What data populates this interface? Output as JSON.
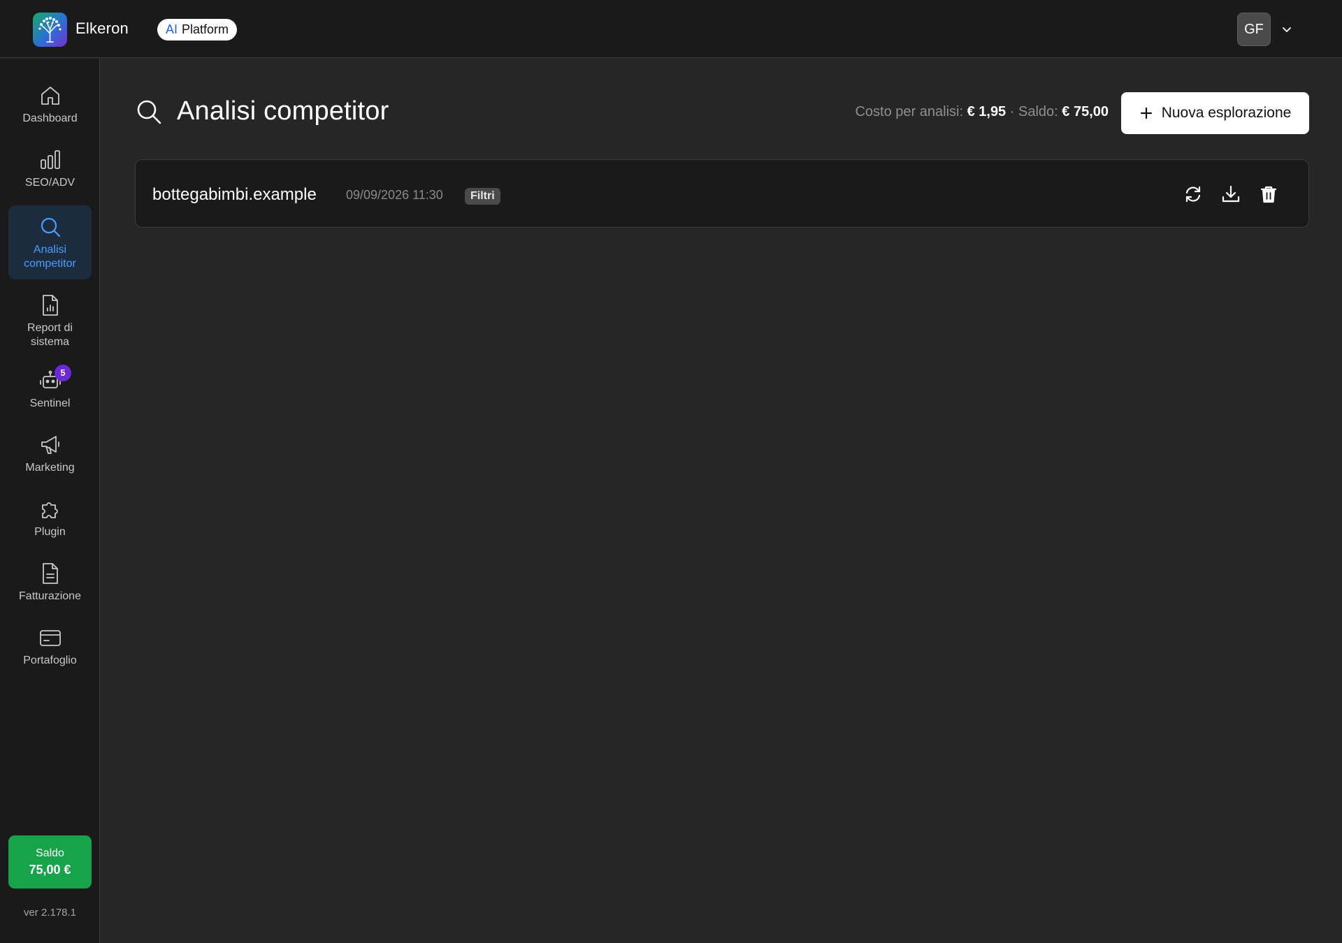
{
  "app": {
    "brand": "Elkeron",
    "platform_badge_prefix": "AI",
    "platform_badge_label": "Platform",
    "user_initials": "GF"
  },
  "sidebar": {
    "items": [
      {
        "label": "Dashboard",
        "icon": "home-icon"
      },
      {
        "label": "SEO/ADV",
        "icon": "bar-chart-icon"
      },
      {
        "label": "Analisi competitor",
        "icon": "search-icon",
        "active": true
      },
      {
        "label": "Report di sistema",
        "icon": "report-document-icon"
      },
      {
        "label": "Sentinel",
        "icon": "robot-icon",
        "badge": "5"
      },
      {
        "label": "Marketing",
        "icon": "megaphone-icon"
      },
      {
        "label": "Plugin",
        "icon": "puzzle-icon"
      },
      {
        "label": "Fatturazione",
        "icon": "invoice-icon"
      },
      {
        "label": "Portafoglio",
        "icon": "wallet-card-icon"
      }
    ],
    "balance": {
      "label": "Saldo",
      "value": "75,00 €"
    },
    "version": "ver 2.178.1"
  },
  "main": {
    "title": "Analisi competitor",
    "cost_label": "Costo per analisi:",
    "cost_value": "€ 1,95",
    "separator": "·",
    "balance_label": "Saldo:",
    "balance_value": "€ 75,00",
    "new_button_label": "Nuova esplorazione",
    "rows": [
      {
        "domain": "bottegabimbi.example",
        "date": "09/09/2026 11:30",
        "tag": "Filtri",
        "actions": [
          "refresh-icon",
          "download-icon",
          "trash-icon"
        ]
      }
    ]
  },
  "colors": {
    "accent": "#4a9eff",
    "balance_green": "#16a34a",
    "badge_purple": "#6d28d9",
    "background": "#262626",
    "panel": "#1a1a1a"
  }
}
